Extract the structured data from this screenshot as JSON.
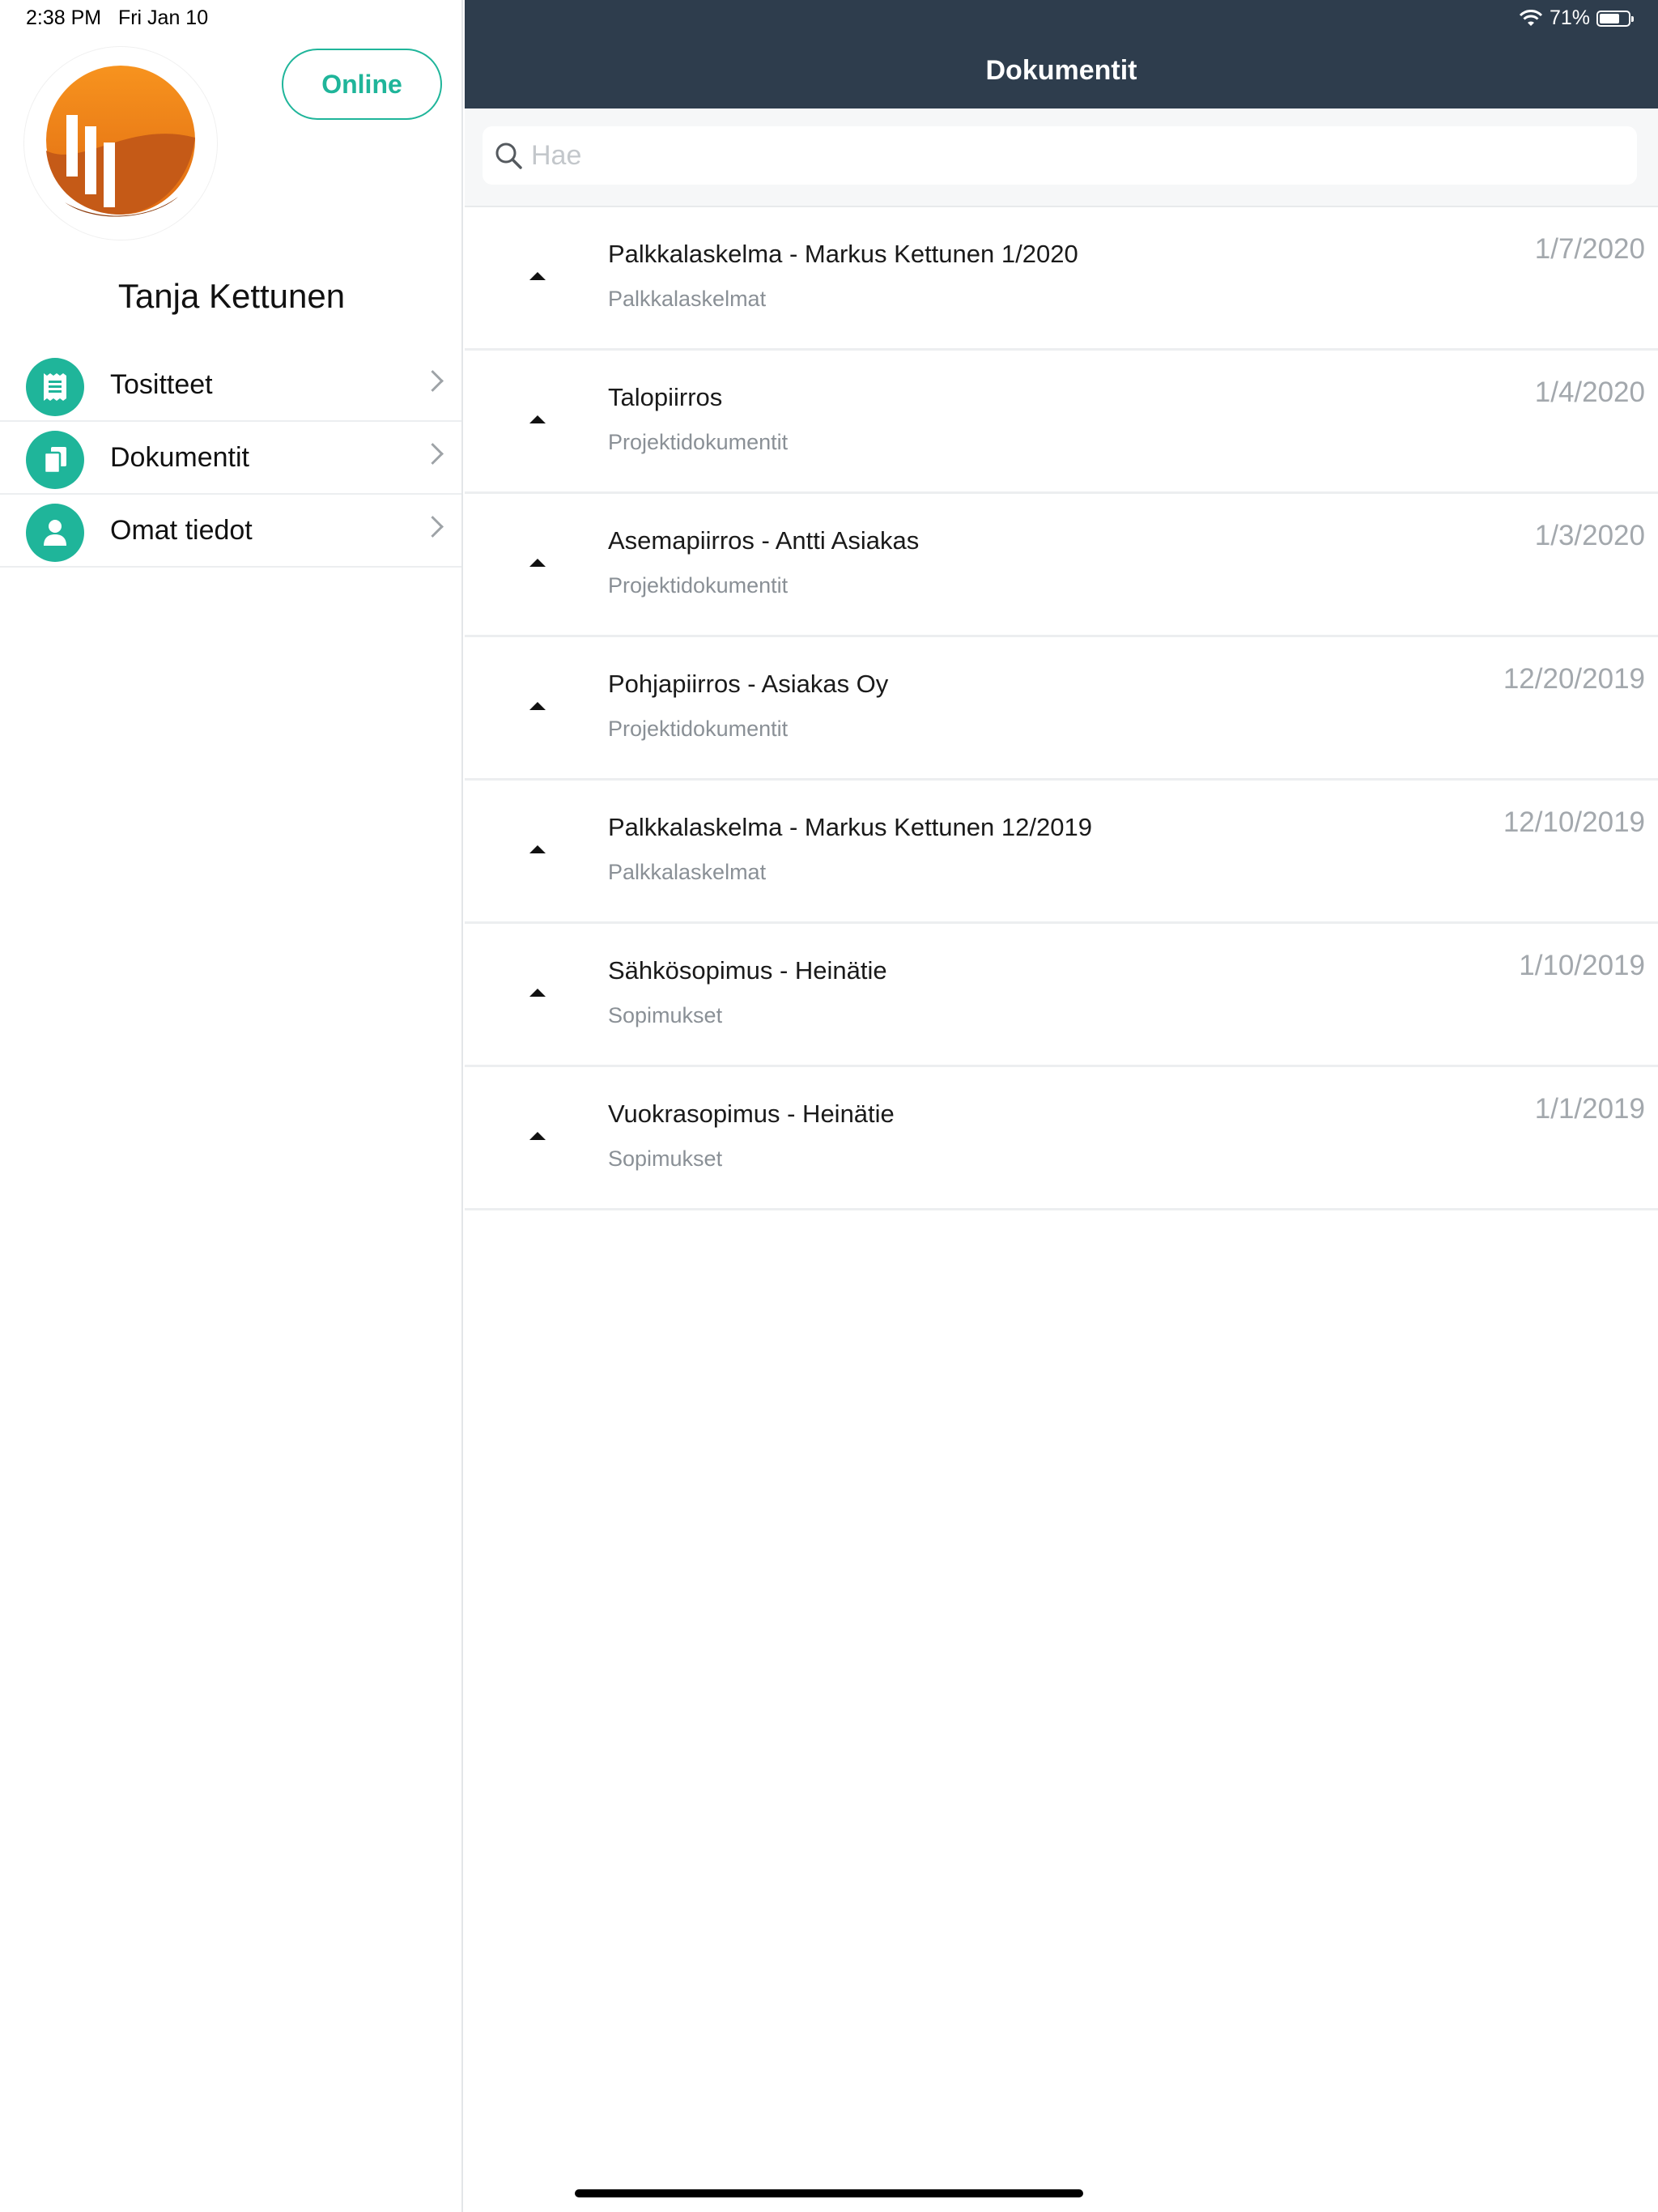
{
  "status_bar": {
    "time": "2:38 PM",
    "date": "Fri Jan 10",
    "wifi_icon": "wifi-icon",
    "battery_percent": "71%",
    "battery_level": 0.71
  },
  "sidebar": {
    "logo_icon": "company-logo",
    "online_label": "Online",
    "user_name": "Tanja Kettunen",
    "items": [
      {
        "label": "Tositteet",
        "icon": "receipt-icon"
      },
      {
        "label": "Dokumentit",
        "icon": "documents-icon"
      },
      {
        "label": "Omat tiedot",
        "icon": "user-icon"
      }
    ]
  },
  "main": {
    "title": "Dokumentit",
    "search": {
      "placeholder": "Hae",
      "value": ""
    },
    "documents": [
      {
        "title": "Palkkalaskelma - Markus Kettunen 1/2020",
        "category": "Palkkalaskelmat",
        "date": "1/7/2020"
      },
      {
        "title": "Talopiirros",
        "category": "Projektidokumentit",
        "date": "1/4/2020"
      },
      {
        "title": "Asemapiirros - Antti Asiakas",
        "category": "Projektidokumentit",
        "date": "1/3/2020"
      },
      {
        "title": "Pohjapiirros - Asiakas Oy",
        "category": "Projektidokumentit",
        "date": "12/20/2019"
      },
      {
        "title": "Palkkalaskelma - Markus Kettunen 12/2019",
        "category": "Palkkalaskelmat",
        "date": "12/10/2019"
      },
      {
        "title": "Sähkösopimus - Heinätie",
        "category": "Sopimukset",
        "date": "1/10/2019"
      },
      {
        "title": "Vuokrasopimus - Heinätie",
        "category": "Sopimukset",
        "date": "1/1/2019"
      }
    ]
  },
  "colors": {
    "accent": "#1fb59a",
    "navbar": "#2e3d4d",
    "logo_orange": "#f0821e"
  }
}
